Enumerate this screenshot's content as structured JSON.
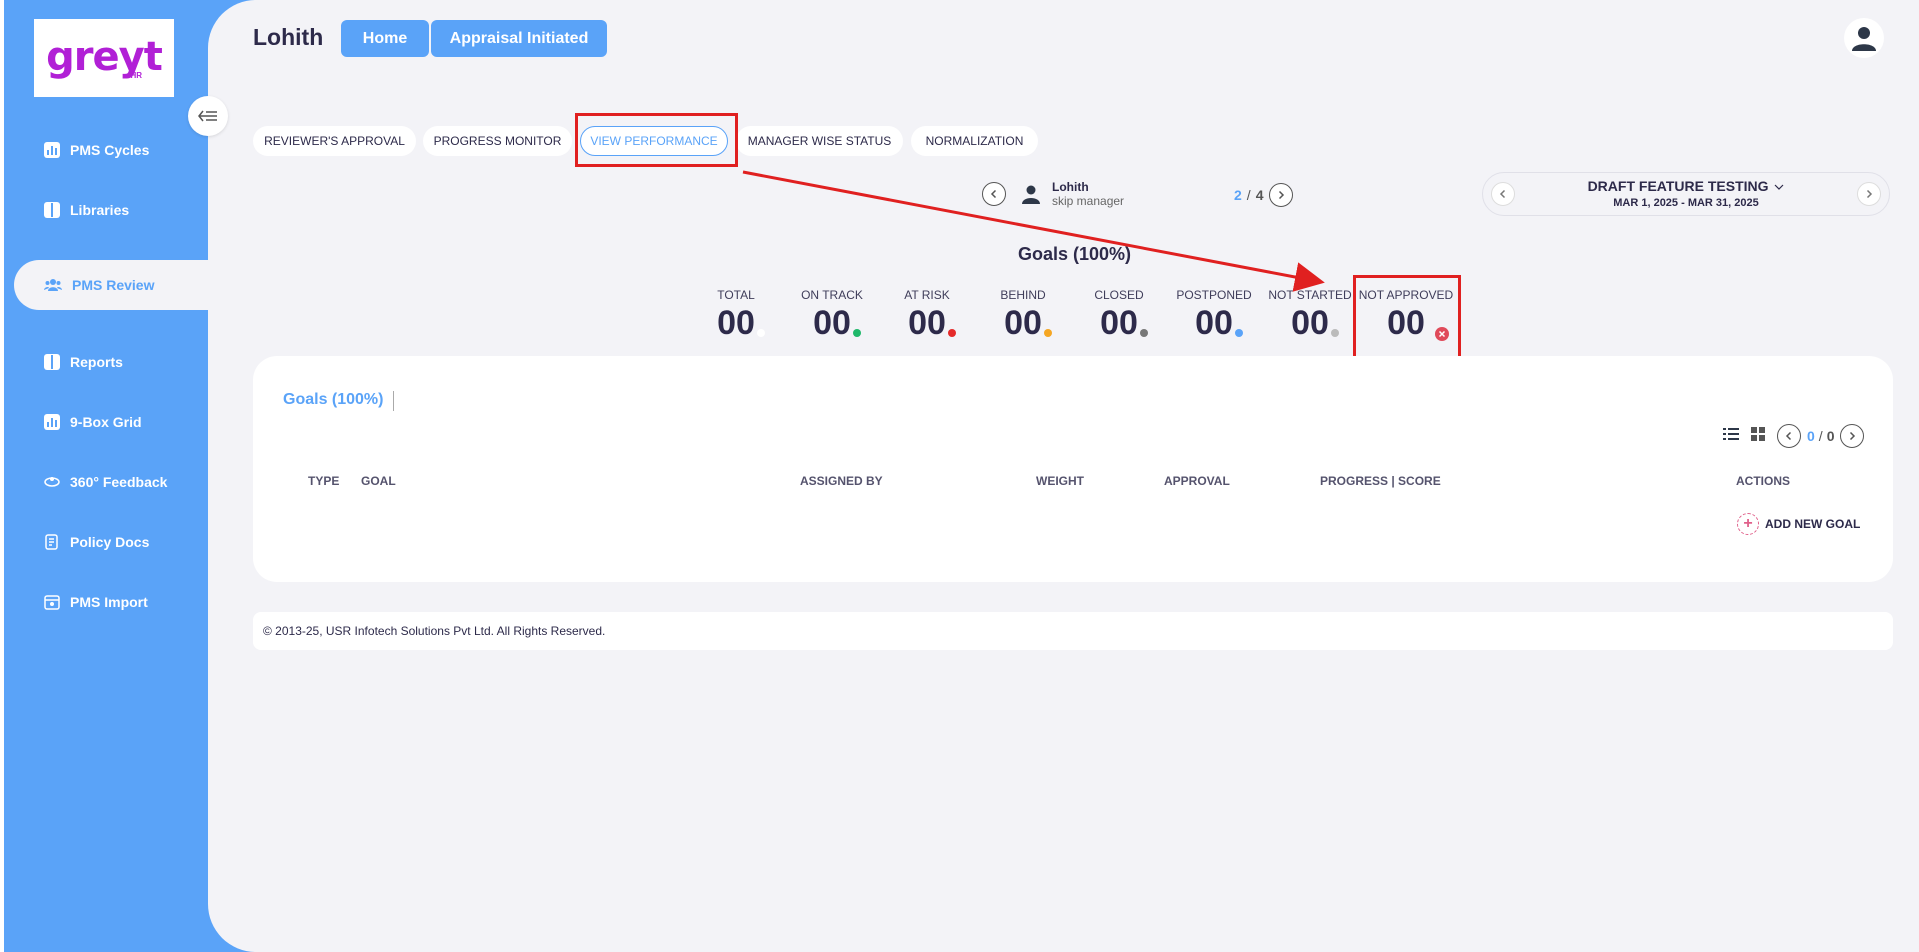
{
  "logo": {
    "word": "greyt",
    "sub": "HR"
  },
  "sidebar": {
    "items": [
      {
        "label": "PMS Cycles",
        "icon": "bar-chart-icon"
      },
      {
        "label": "Libraries",
        "icon": "book-icon"
      },
      {
        "label": "PMS Review",
        "icon": "users-icon",
        "active": true
      },
      {
        "label": "Reports",
        "icon": "book-icon"
      },
      {
        "label": "9-Box Grid",
        "icon": "bar-chart-icon"
      },
      {
        "label": "360° Feedback",
        "icon": "feedback-icon"
      },
      {
        "label": "Policy Docs",
        "icon": "document-icon"
      },
      {
        "label": "PMS Import",
        "icon": "import-icon"
      }
    ]
  },
  "header": {
    "title": "Lohith",
    "home_label": "Home",
    "status_label": "Appraisal Initiated"
  },
  "tabs": [
    {
      "label": "REVIEWER'S APPROVAL"
    },
    {
      "label": "PROGRESS MONITOR"
    },
    {
      "label": "VIEW PERFORMANCE",
      "active": true
    },
    {
      "label": "MANAGER WISE STATUS"
    },
    {
      "label": "NORMALIZATION"
    }
  ],
  "employee": {
    "name": "Lohith",
    "role": "skip manager"
  },
  "pager": {
    "current": "2",
    "sep": "/",
    "total": "4"
  },
  "cycle": {
    "title": "DRAFT FEATURE TESTING",
    "dates": "MAR 1, 2025 - MAR 31, 2025"
  },
  "goals_heading": "Goals (100%)",
  "stats": [
    {
      "label": "TOTAL",
      "value": "00",
      "color": "#ffffff"
    },
    {
      "label": "ON TRACK",
      "value": "00",
      "color": "#1fb86a"
    },
    {
      "label": "AT RISK",
      "value": "00",
      "color": "#e52a2a"
    },
    {
      "label": "BEHIND",
      "value": "00",
      "color": "#f5a623"
    },
    {
      "label": "CLOSED",
      "value": "00",
      "color": "#777777"
    },
    {
      "label": "POSTPONED",
      "value": "00",
      "color": "#5aa3f8"
    },
    {
      "label": "NOT STARTED",
      "value": "00",
      "color": "#bbbbbb"
    },
    {
      "label": "NOT APPROVED",
      "value": "00",
      "color": "#e04a5a"
    }
  ],
  "card": {
    "tab_label": "Goals (100%)",
    "pager": {
      "current": "0",
      "sep": "/",
      "total": "0"
    },
    "columns": [
      "TYPE",
      "GOAL",
      "ASSIGNED BY",
      "WEIGHT",
      "APPROVAL",
      "PROGRESS | SCORE",
      "ACTIONS"
    ],
    "add_goal_label": "ADD NEW GOAL"
  },
  "footer": {
    "text": "© 2013-25, USR Infotech Solutions Pvt Ltd. All Rights Reserved."
  }
}
